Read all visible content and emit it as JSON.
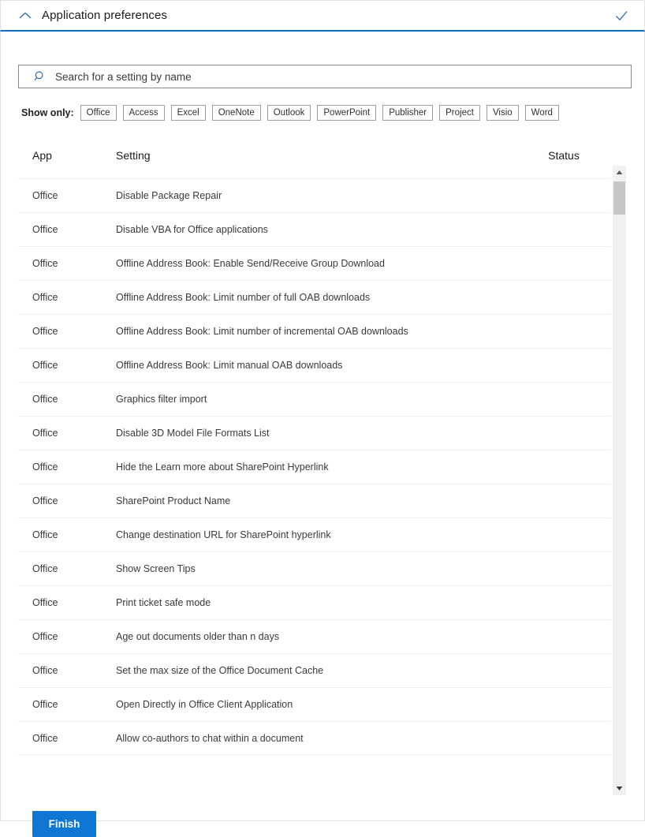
{
  "header": {
    "title": "Application preferences",
    "collapse_icon": "chevron-up-icon",
    "confirm_icon": "checkmark-icon"
  },
  "search": {
    "placeholder": "Search for a setting by name",
    "value": "",
    "icon": "search-icon"
  },
  "filters": {
    "label": "Show only:",
    "chips": [
      "Office",
      "Access",
      "Excel",
      "OneNote",
      "Outlook",
      "PowerPoint",
      "Publisher",
      "Project",
      "Visio",
      "Word"
    ]
  },
  "table": {
    "columns": [
      "App",
      "Setting",
      "Status"
    ],
    "rows": [
      {
        "app": "Office",
        "setting": "Disable Package Repair",
        "status": ""
      },
      {
        "app": "Office",
        "setting": "Disable VBA for Office applications",
        "status": ""
      },
      {
        "app": "Office",
        "setting": "Offline Address Book: Enable Send/Receive Group Download",
        "status": ""
      },
      {
        "app": "Office",
        "setting": "Offline Address Book: Limit number of full OAB downloads",
        "status": ""
      },
      {
        "app": "Office",
        "setting": "Offline Address Book: Limit number of incremental OAB downloads",
        "status": ""
      },
      {
        "app": "Office",
        "setting": "Offline Address Book: Limit manual OAB downloads",
        "status": ""
      },
      {
        "app": "Office",
        "setting": "Graphics filter import",
        "status": ""
      },
      {
        "app": "Office",
        "setting": "Disable 3D Model File Formats List",
        "status": ""
      },
      {
        "app": "Office",
        "setting": "Hide the Learn more about SharePoint Hyperlink",
        "status": ""
      },
      {
        "app": "Office",
        "setting": "SharePoint Product Name",
        "status": ""
      },
      {
        "app": "Office",
        "setting": "Change destination URL for SharePoint hyperlink",
        "status": ""
      },
      {
        "app": "Office",
        "setting": "Show Screen Tips",
        "status": ""
      },
      {
        "app": "Office",
        "setting": "Print ticket safe mode",
        "status": ""
      },
      {
        "app": "Office",
        "setting": "Age out documents older than n days",
        "status": ""
      },
      {
        "app": "Office",
        "setting": "Set the max size of the Office Document Cache",
        "status": ""
      },
      {
        "app": "Office",
        "setting": "Open Directly in Office Client Application",
        "status": ""
      },
      {
        "app": "Office",
        "setting": "Allow co-authors to chat within a document",
        "status": ""
      }
    ]
  },
  "scrollbar": {
    "up_icon": "scroll-up-arrow-icon",
    "down_icon": "scroll-down-arrow-icon"
  },
  "footer": {
    "finish_label": "Finish"
  },
  "colors": {
    "accent": "#0f6cbd",
    "primary_button": "#0f76d4",
    "border": "#e1e1e1",
    "row_divider": "#ededed",
    "text": "#323130"
  }
}
